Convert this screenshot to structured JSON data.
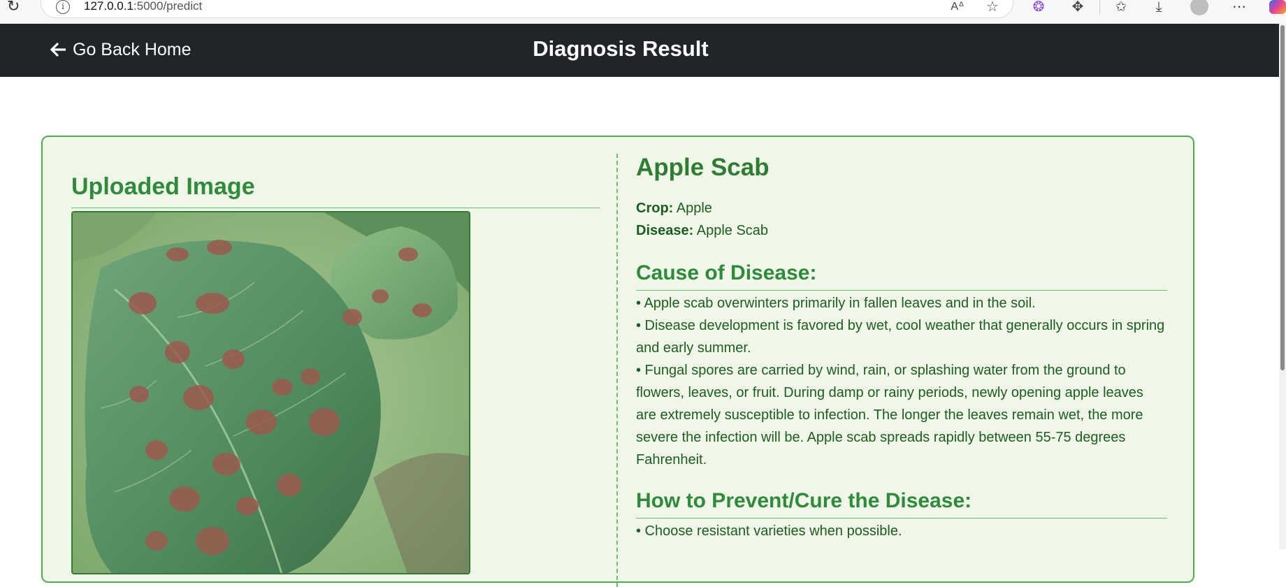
{
  "browser": {
    "url_host": "127.0.0.1",
    "url_path": ":5000/predict"
  },
  "header": {
    "back_label": "Go Back Home",
    "title": "Diagnosis Result"
  },
  "left": {
    "title": "Uploaded Image"
  },
  "result": {
    "disease_title": "Apple Scab",
    "crop_label": "Crop:",
    "crop_value": "Apple",
    "disease_label": "Disease:",
    "disease_value": "Apple Scab",
    "cause_heading": "Cause of Disease:",
    "cause_items": [
      "• Apple scab overwinters primarily in fallen leaves and in the soil.",
      "• Disease development is favored by wet, cool weather that generally occurs in spring and early summer.",
      "• Fungal spores are carried by wind, rain, or splashing water from the ground to flowers, leaves, or fruit. During damp or rainy periods, newly opening apple leaves are extremely susceptible to infection. The longer the leaves remain wet, the more severe the infection will be. Apple scab spreads rapidly between 55-75 degrees Fahrenheit."
    ],
    "prevent_heading": "How to Prevent/Cure the Disease:",
    "prevent_items": [
      "• Choose resistant varieties when possible."
    ]
  },
  "colors": {
    "header_bg": "#212529",
    "card_bg": "#f0f6e8",
    "card_border": "#4caf50",
    "heading_green": "#2e8b3a",
    "text_green": "#1b5e20"
  }
}
